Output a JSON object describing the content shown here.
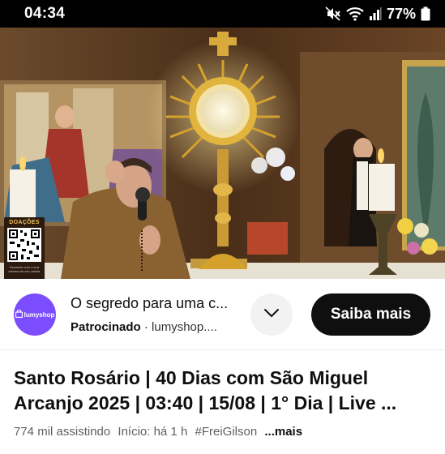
{
  "status_bar": {
    "time": "04:34",
    "battery": "77%",
    "icons": [
      "mute-icon",
      "wifi-icon",
      "signal-icon",
      "battery-icon"
    ]
  },
  "video": {
    "donation_label": "DOAÇÕES",
    "donation_small": "Escaneie com a sua câmera do seu celular"
  },
  "ad": {
    "logo_text": "lumyshop",
    "title": "O segredo para uma c...",
    "sponsored": "Patrocinado",
    "separator": "·",
    "domain": "lumyshop....",
    "cta": "Saiba mais",
    "colors": {
      "logo_bg": "#7c4dff",
      "cta_bg": "#0f0f0f"
    }
  },
  "details": {
    "title": "Santo Rosário | 40 Dias com São Miguel Arcanjo 2025 | 03:40 | 15/08 | 1° Dia | Live ...",
    "viewers": "774 mil assistindo",
    "started": "Início: há 1 h",
    "hashtag": "#FreiGilson",
    "more": "...mais"
  }
}
